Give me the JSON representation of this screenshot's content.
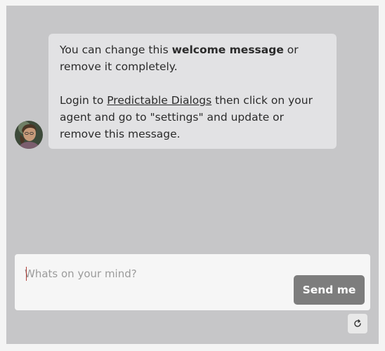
{
  "welcome_message": {
    "line1_before": "You can change this ",
    "line1_bold": "welcome message",
    "line1_after": " or remove it completely.",
    "line2_before": "Login to ",
    "line2_link": "Predictable Dialogs",
    "line2_after": " then click on your agent and go to \"settings\" and update or remove this message."
  },
  "composer": {
    "placeholder": "Whats on your mind?",
    "value": "",
    "send_label": "Send me"
  },
  "icons": {
    "avatar": "bot-avatar-photo",
    "restart": "refresh-icon"
  },
  "colors": {
    "panel_bg": "#c6c6c8",
    "bubble_bg": "#e2e2e4",
    "send_button_bg": "#7d7d7d"
  }
}
